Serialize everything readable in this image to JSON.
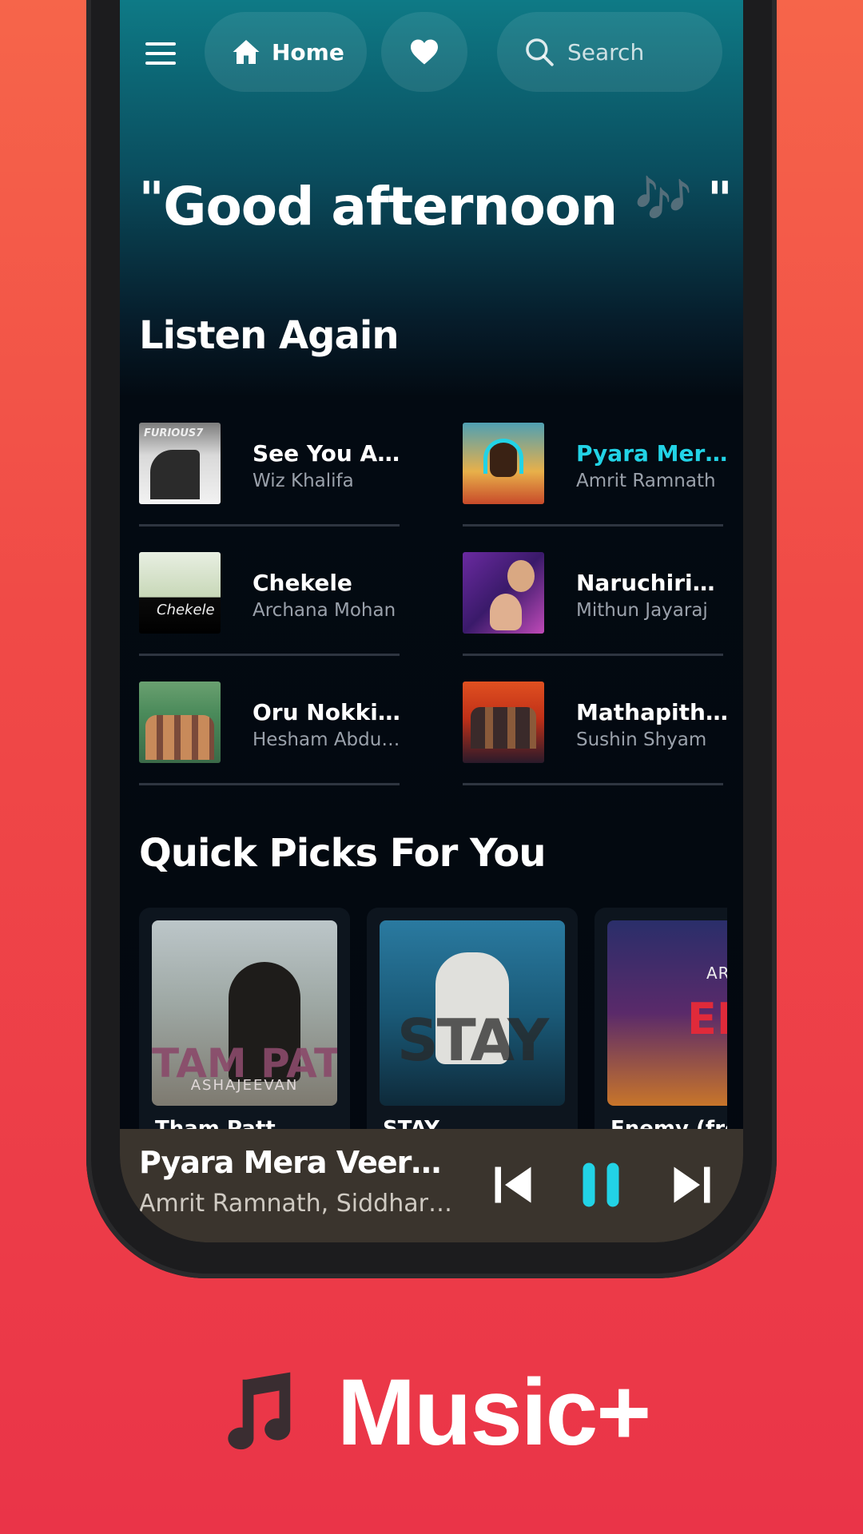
{
  "nav": {
    "home_label": "Home",
    "search_placeholder": "Search"
  },
  "greeting": {
    "open_quote": "\"",
    "text": "Good afternoon ",
    "note": "🎶",
    "close_quote": " \""
  },
  "listen_again": {
    "title": "Listen Again",
    "songs": [
      {
        "title": "See You Again",
        "artist": "Wiz Khalifa",
        "thumb_text": "FURIOUS7",
        "active": false
      },
      {
        "title": "Pyara Mera Veera",
        "artist": "Amrit Ramnath",
        "thumb_text": "",
        "active": true
      },
      {
        "title": "Chekele",
        "artist": "Archana Mohan",
        "thumb_text": "Chekele",
        "active": false
      },
      {
        "title": "Naruchiriyum",
        "artist": "Mithun Jayaraj",
        "thumb_text": "",
        "active": false
      },
      {
        "title": "Oru Nokkil - Oru Jaathi Jathakam",
        "artist": "Hesham Abdul Wahab",
        "thumb_text": "",
        "active": false
      },
      {
        "title": "Mathapithakkale",
        "artist": "Sushin Shyam",
        "thumb_text": "",
        "active": false
      }
    ]
  },
  "quick_picks": {
    "title": "Quick Picks For You",
    "cards": [
      {
        "caption": "Tham Patt",
        "art_big": "TAM PATT",
        "art_small": "ASHAJEEVAN"
      },
      {
        "caption": "STAY",
        "art_big": "STAY",
        "art_small": ""
      },
      {
        "caption": "Enemy (from",
        "art_big": "ENEM",
        "art_small": "ARCANE"
      }
    ]
  },
  "player": {
    "title": "Pyara Mera Veera (From \"Empuraan\")",
    "artist": "Amrit Ramnath, Siddharth Menon",
    "accent_color": "#22d3e6"
  },
  "brand": {
    "name": "Music+",
    "icon": "music-note-icon"
  }
}
